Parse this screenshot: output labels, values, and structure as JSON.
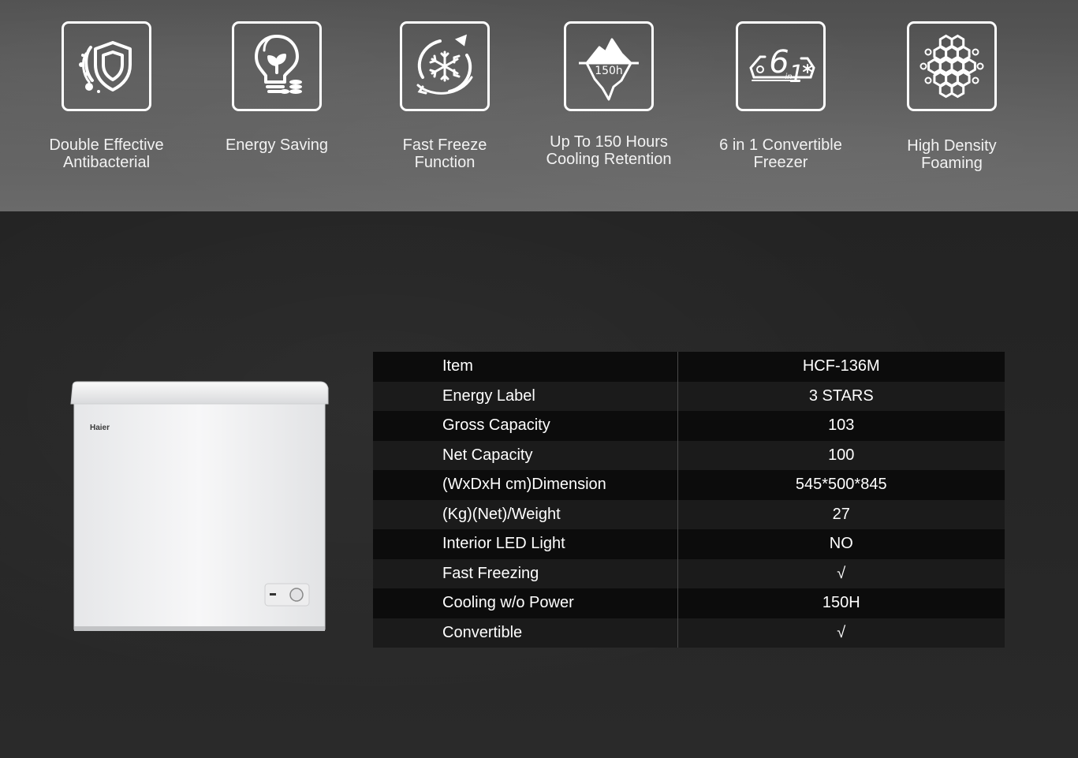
{
  "features": [
    {
      "icon": "antibacterial-shield-icon",
      "label": "Double Effective\nAntibacterial"
    },
    {
      "icon": "energy-saving-bulb-icon",
      "label": "Energy Saving"
    },
    {
      "icon": "fast-freeze-snowflake-icon",
      "label": "Fast Freeze\nFunction"
    },
    {
      "icon": "iceberg-150h-icon",
      "icon_text": "150h",
      "label": "Up To 150 Hours\nCooling Retention"
    },
    {
      "icon": "six-in-one-icon",
      "icon_text": "6",
      "icon_sub": "in",
      "icon_one": "1",
      "label": "6 in 1 Convertible\nFreezer"
    },
    {
      "icon": "honeycomb-foam-icon",
      "label": "High Density\nFoaming"
    }
  ],
  "product": {
    "brand": "Haier",
    "image": "chest-freezer-image"
  },
  "specs": {
    "rows": [
      {
        "label": "Item",
        "value": "HCF-136M"
      },
      {
        "label": "Energy Label",
        "value": "3 STARS"
      },
      {
        "label": "Gross Capacity",
        "value": "103"
      },
      {
        "label": "Net Capacity",
        "value": "100"
      },
      {
        "label": "(WxDxH cm)Dimension",
        "value": "545*500*845"
      },
      {
        "label": "(Kg)(Net)/Weight",
        "value": "27"
      },
      {
        "label": "Interior LED Light",
        "value": "NO"
      },
      {
        "label": "Fast Freezing",
        "value": "√"
      },
      {
        "label": "Cooling w/o Power",
        "value": "150H"
      },
      {
        "label": "Convertible",
        "value": "√"
      }
    ]
  },
  "colors": {
    "top_band": "#5a5a5a",
    "bottom_band": "#262626",
    "table_row_dark": "#0c0c0c",
    "table_row_light": "#1b1b1b",
    "text": "#ffffff"
  }
}
